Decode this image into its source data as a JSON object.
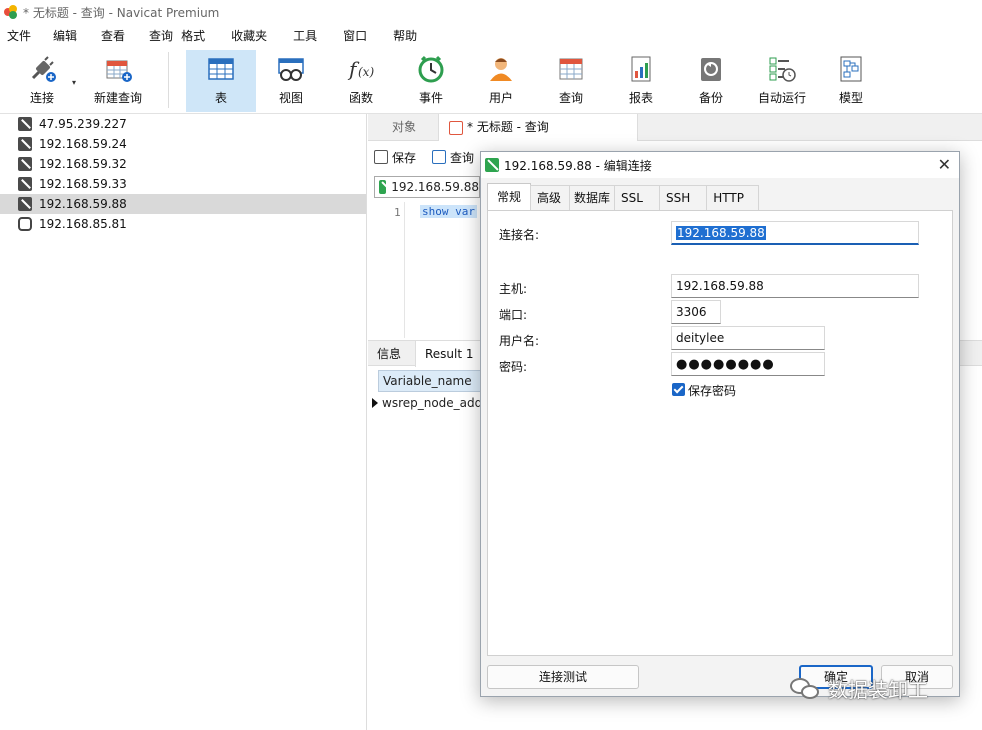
{
  "window": {
    "title": "* 无标题 - 查询 - Navicat Premium"
  },
  "menu": [
    "文件",
    "编辑",
    "查看",
    "查询",
    "格式",
    "收藏夹",
    "工具",
    "窗口",
    "帮助"
  ],
  "toolbar": {
    "connect": "连接",
    "new_query": "新建查询",
    "table": "表",
    "view": "视图",
    "function": "函数",
    "event": "事件",
    "user": "用户",
    "query": "查询",
    "report": "报表",
    "backup": "备份",
    "automation": "自动运行",
    "model": "模型"
  },
  "connections": [
    "47.95.239.227",
    "192.168.59.24",
    "192.168.59.32",
    "192.168.59.33",
    "192.168.59.88",
    "192.168.85.81"
  ],
  "main": {
    "tab_objects": "对象",
    "tab_query": "* 无标题 - 查询",
    "save": "保存",
    "query_builder": "查询",
    "connection": "192.168.59.88",
    "line_number": "1",
    "code": "show var",
    "result_tab_info": "信息",
    "result_tab_result": "Result 1",
    "column_header": "Variable_name",
    "row_value": "wsrep_node_add"
  },
  "dialog": {
    "title": "192.168.59.88 - 编辑连接",
    "close": "✕",
    "tabs": [
      "常规",
      "高级",
      "数据库",
      "SSL",
      "SSH",
      "HTTP"
    ],
    "conn_name_label": "连接名:",
    "conn_name_value": "192.168.59.88",
    "host_label": "主机:",
    "host_value": "192.168.59.88",
    "port_label": "端口:",
    "port_value": "3306",
    "user_label": "用户名:",
    "user_value": "deitylee",
    "password_label": "密码:",
    "password_value": "●●●●●●●●",
    "save_password_label": "保存密码",
    "save_password_checked": true,
    "test_button": "连接测试",
    "ok_button": "确定",
    "cancel_button": "取消"
  },
  "watermark": {
    "text": "数据装卸工"
  },
  "colors": {
    "accent": "#1a66c7",
    "toolbar_active": "#cfe6f8",
    "selected_row": "#d9d9d9"
  }
}
